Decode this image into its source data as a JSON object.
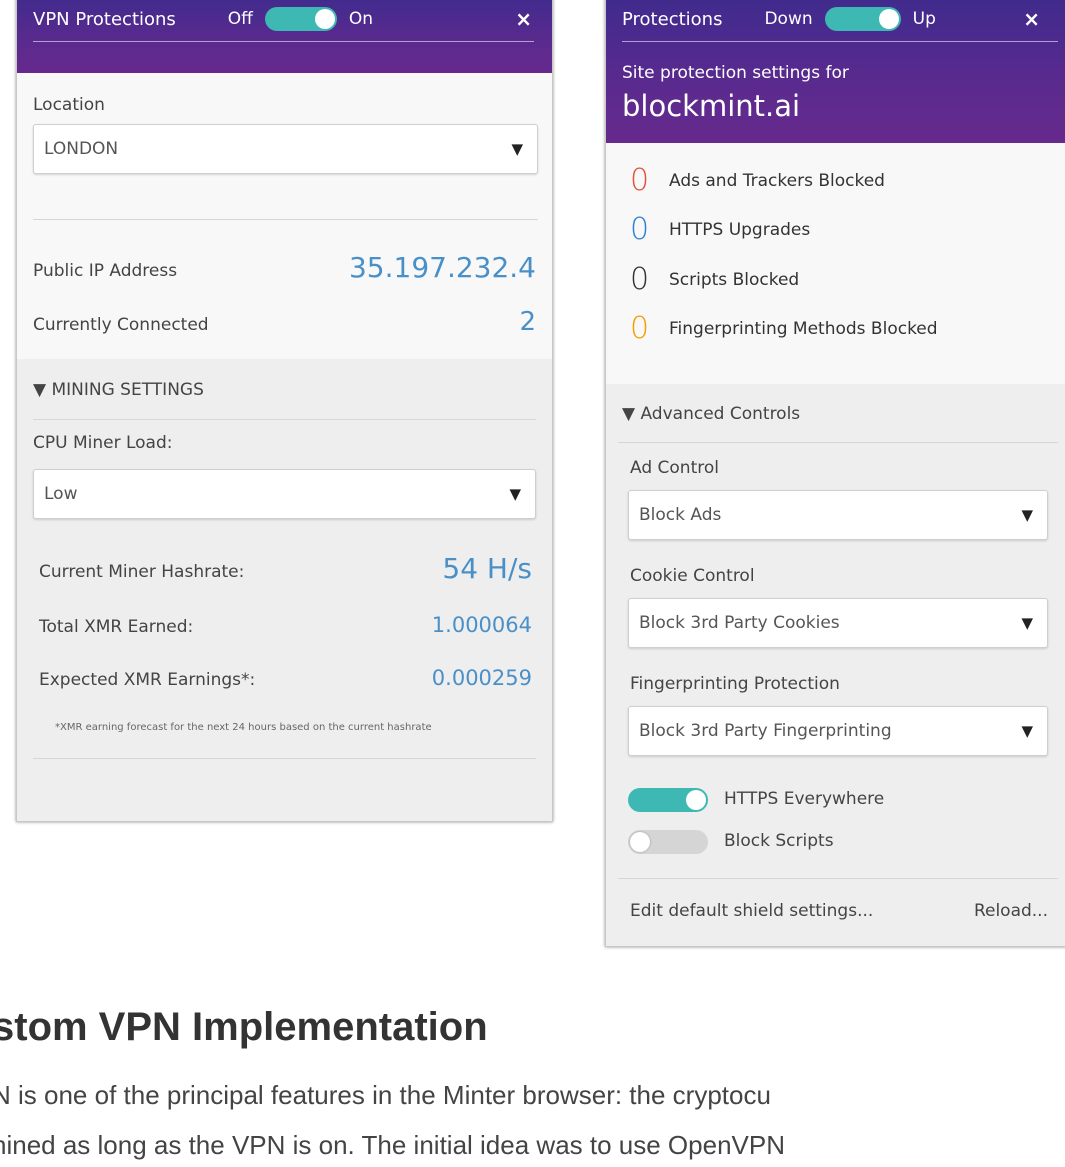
{
  "vpn": {
    "title": "VPN Protections",
    "toggle_off_label": "Off",
    "toggle_on_label": "On",
    "toggle_on": true,
    "close": "×",
    "location_label": "Location",
    "location_value": "LONDON",
    "public_ip_label": "Public IP Address",
    "public_ip_value": "35.197.232.4",
    "connected_label": "Currently Connected",
    "connected_value": "2",
    "mining_settings_label": "▼ MINING SETTINGS",
    "cpu_load_label": "CPU Miner Load:",
    "cpu_load_value": "Low",
    "hashrate_label": "Current Miner Hashrate:",
    "hashrate_value": "54 H/s",
    "total_label": "Total XMR Earned:",
    "total_value": "1.000064",
    "expected_label": "Expected XMR Earnings*:",
    "expected_value": "0.000259",
    "footnote": "*XMR earning forecast for the next 24 hours based on the current hashrate"
  },
  "shield": {
    "title": "Protections",
    "toggle_down_label": "Down",
    "toggle_up_label": "Up",
    "toggle_on": true,
    "close": "×",
    "site_subtitle": "Site protection settings for",
    "site_name": "blockmint.ai",
    "stats": [
      {
        "count": "0",
        "label": "Ads and Trackers Blocked",
        "color": "#e0523a"
      },
      {
        "count": "0",
        "label": "HTTPS Upgrades",
        "color": "#2e7fd6"
      },
      {
        "count": "0",
        "label": "Scripts Blocked",
        "color": "#333333"
      },
      {
        "count": "0",
        "label": "Fingerprinting Methods Blocked",
        "color": "#f2a000"
      }
    ],
    "advanced_label": "▼ Advanced Controls",
    "ad_control_label": "Ad Control",
    "ad_control_value": "Block Ads",
    "cookie_control_label": "Cookie Control",
    "cookie_control_value": "Block 3rd Party Cookies",
    "fingerprint_label": "Fingerprinting Protection",
    "fingerprint_value": "Block 3rd Party Fingerprinting",
    "https_everywhere_label": "HTTPS Everywhere",
    "https_everywhere_on": true,
    "block_scripts_label": "Block Scripts",
    "block_scripts_on": false,
    "edit_defaults_link": "Edit default shield settings...",
    "reload_link": "Reload..."
  },
  "article": {
    "heading": "stom VPN Implementation",
    "line1": "N is one of the principal features in the Minter browser: the cryptocu",
    "line2": "nined as long as the VPN is on. The initial idea was to use OpenVPN"
  },
  "colors": {
    "header_purple": "#5a2a8e",
    "toggle_teal": "#3eb8b2",
    "value_blue": "#4a90c8"
  }
}
